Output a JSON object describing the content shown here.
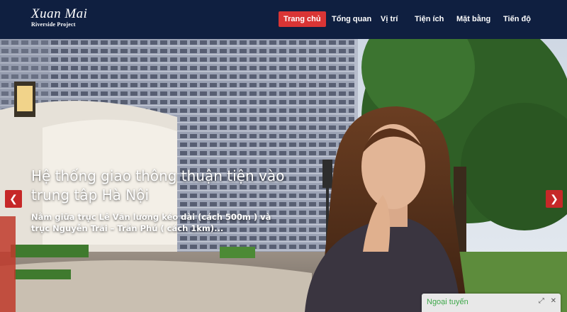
{
  "logo": {
    "name": "Xuan Mai",
    "subtitle": "Riverside Project"
  },
  "nav": {
    "items": [
      {
        "label": "Trang chủ",
        "active": true
      },
      {
        "label": "Tổng quan",
        "active": false
      },
      {
        "label": "Vị trí",
        "active": false
      },
      {
        "label": "Tiện ích",
        "active": false
      },
      {
        "label": "Mặt bằng",
        "active": false
      },
      {
        "label": "Tiến độ",
        "active": false
      }
    ]
  },
  "slider": {
    "title": "Hệ thống giao thông thuận tiện vào trung tâp Hà Nội",
    "description": "Nằm giữa trục Lê Văn lương kéo dài (cách 500m ) và trục Nguyễn Trãi – Trần Phú ( cách 1km)...",
    "prev_icon": "chevron-left-icon",
    "next_icon": "chevron-right-icon"
  },
  "chat": {
    "status_label": "Ngoại tuyến",
    "icons": [
      "expand-icon",
      "close-icon"
    ]
  },
  "colors": {
    "header_bg": "#0f1f40",
    "active_nav": "#d93535",
    "arrow_bg": "#c62828",
    "chat_status": "#3ea84a"
  }
}
